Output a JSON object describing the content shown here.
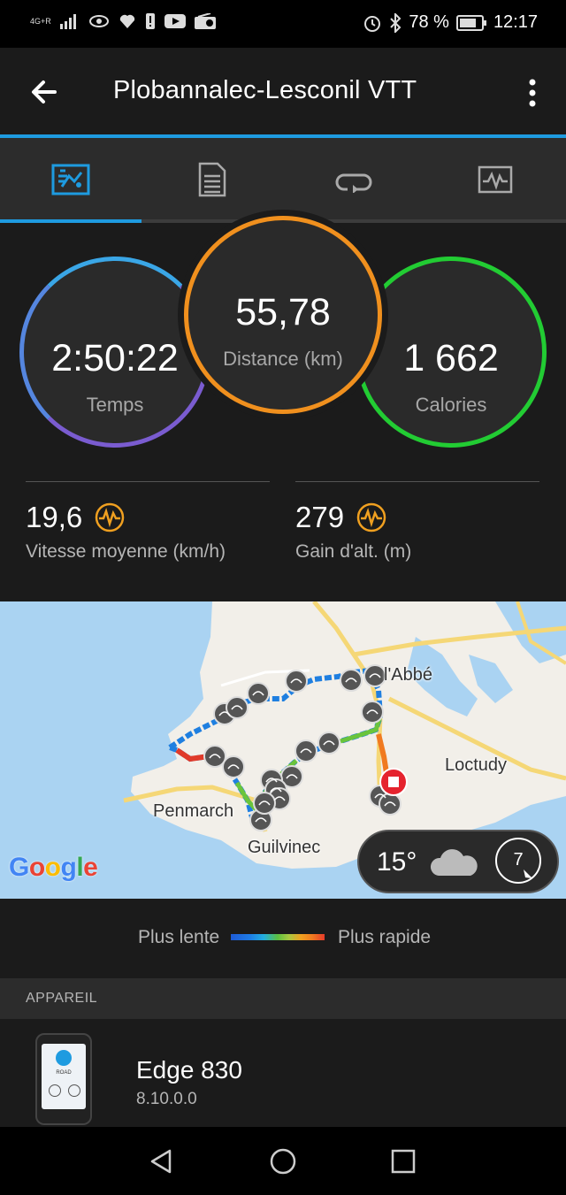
{
  "status_bar": {
    "network": "4G+R",
    "battery_text": "78 %",
    "time": "12:17"
  },
  "header": {
    "title": "Plobannalec-Lesconil VTT"
  },
  "tabs": [
    {
      "name": "overview",
      "icon": "overview-icon"
    },
    {
      "name": "details",
      "icon": "document-icon"
    },
    {
      "name": "laps",
      "icon": "loop-icon"
    },
    {
      "name": "charts",
      "icon": "chart-icon"
    }
  ],
  "metrics": {
    "time": {
      "value": "2:50:22",
      "label": "Temps"
    },
    "distance": {
      "value": "55,78",
      "label": "Distance (km)"
    },
    "calories": {
      "value": "1 662",
      "label": "Calories"
    }
  },
  "stats": {
    "avg_speed": {
      "value": "19,6",
      "label": "Vitesse moyenne (km/h)"
    },
    "elev_gain": {
      "value": "279",
      "label": "Gain d'alt. (m)"
    }
  },
  "map": {
    "labels": {
      "labbe": "l'Abbé",
      "loctudy": "Loctudy",
      "penmarch": "Penmarch",
      "guilvinec": "Guilvinec"
    },
    "google": "Google",
    "weather": {
      "temp": "15°",
      "wind": "7"
    }
  },
  "speed_legend": {
    "slow": "Plus lente",
    "fast": "Plus rapide"
  },
  "device_section": {
    "header": "APPAREIL",
    "name": "Edge 830",
    "version": "8.10.0.0",
    "screen": {
      "top": "ROAD"
    }
  },
  "colors": {
    "accent_blue": "#1e9be0",
    "time_ring": "#7a5cd0",
    "distance_ring": "#f0901e",
    "calories_ring": "#22cc33",
    "stat_icon": "#f0a020"
  }
}
